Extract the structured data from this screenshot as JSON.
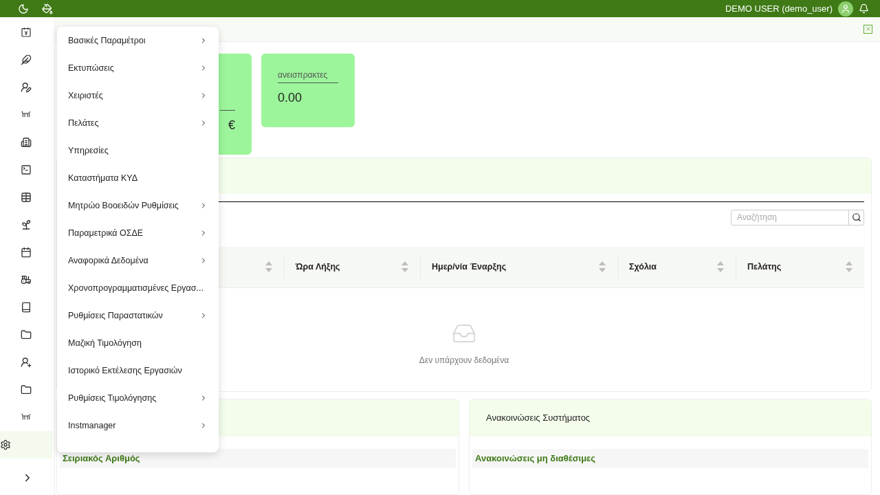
{
  "topbar": {
    "user": "DEMO USER (demo_user)"
  },
  "sidebar": {
    "items": [
      {
        "selected": false
      },
      {
        "selected": false
      },
      {
        "selected": false
      },
      {
        "selected": false
      },
      {
        "selected": false
      },
      {
        "selected": false
      },
      {
        "selected": false
      },
      {
        "selected": false
      },
      {
        "selected": false
      },
      {
        "selected": false
      },
      {
        "selected": false
      },
      {
        "selected": false
      },
      {
        "selected": false
      },
      {
        "selected": false
      },
      {
        "selected": false
      },
      {
        "selected": true
      }
    ]
  },
  "menu": {
    "items": [
      {
        "label": "Βασικές Παραμέτροι",
        "submenu": true
      },
      {
        "label": "Εκτυπώσεις",
        "submenu": true
      },
      {
        "label": "Χειριστές",
        "submenu": true
      },
      {
        "label": "Πελάτες",
        "submenu": true
      },
      {
        "label": "Υπηρεσίες",
        "submenu": false
      },
      {
        "label": "Καταστήματα ΚΥΔ",
        "submenu": false
      },
      {
        "label": "Μητρώο Βοοειδών Ρυθμίσεις",
        "submenu": true
      },
      {
        "label": "Παραμετρικά ΟΣΔΕ",
        "submenu": true
      },
      {
        "label": "Αναφορικά Δεδομένα",
        "submenu": true
      },
      {
        "label": "Χρονοπρογραμματισμένες Εργασ...",
        "submenu": false
      },
      {
        "label": "Ρυθμίσεις Παραστατικών",
        "submenu": true
      },
      {
        "label": "Μαζική Τιμολόγηση",
        "submenu": false
      },
      {
        "label": "Ιστορικό Εκτέλεσης Εργασιών",
        "submenu": false
      },
      {
        "label": "Ρυθμίσεις Τιμολόγησης",
        "submenu": true
      },
      {
        "label": "Instmanager",
        "submenu": true
      }
    ]
  },
  "cards": [
    {
      "value": "€"
    },
    {
      "label": "ανεισπρακτες",
      "value": "0.00"
    }
  ],
  "table": {
    "search": {
      "placeholder": "Αναζήτηση"
    },
    "columns": [
      {},
      {
        "label": "Ώρα Λήξης"
      },
      {
        "label": "Ημερ/νία Έναρξης"
      },
      {
        "label": "Σχόλια"
      },
      {
        "label": "Πελάτης"
      }
    ],
    "empty": "Δεν υπάρχουν δεδομένα"
  },
  "bottom_left": {
    "heading": "Σειριακός Αριθμός"
  },
  "bottom_right": {
    "title": "Ανακοινώσεις Συστήματος",
    "heading": "Ανακοινώσεις μη διαθέσιμες"
  }
}
